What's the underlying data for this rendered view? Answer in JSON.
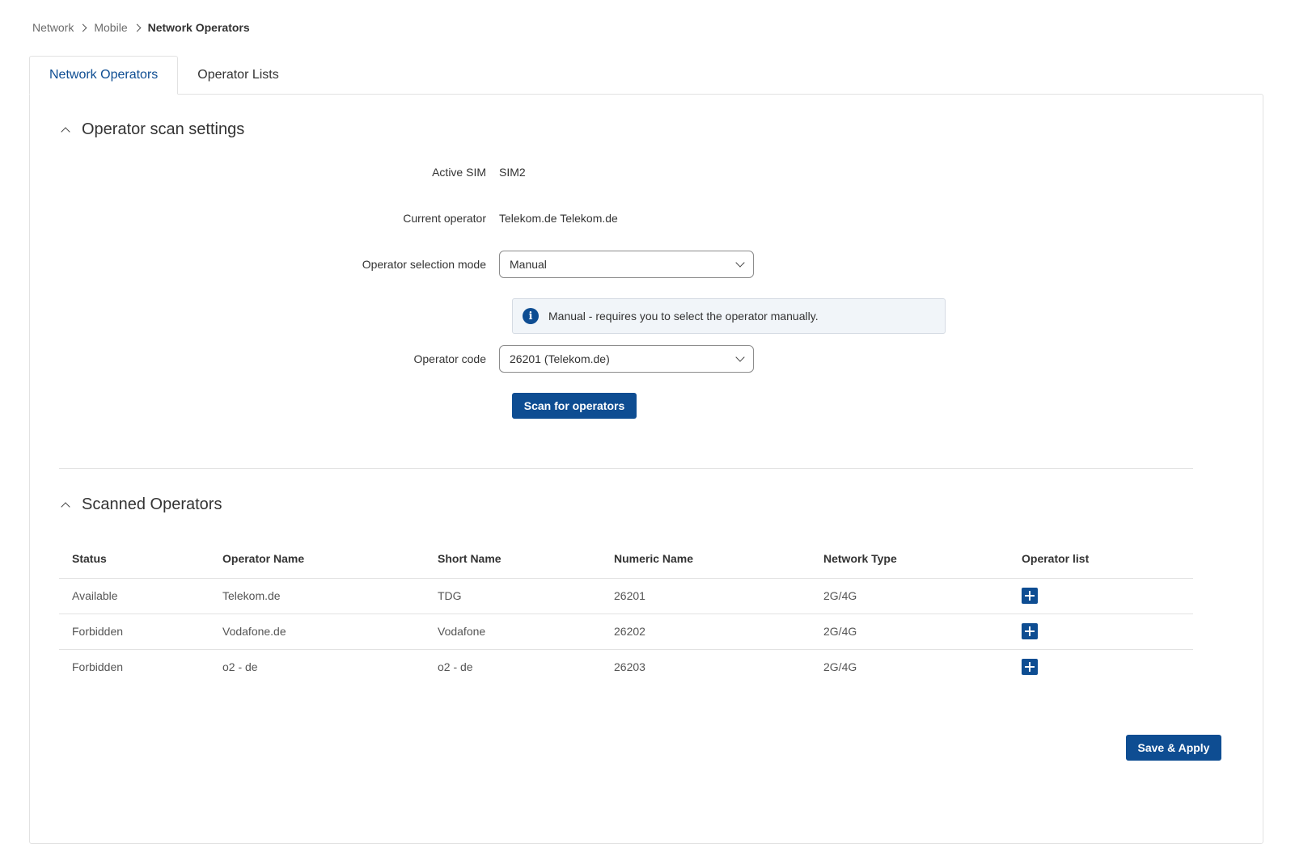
{
  "breadcrumb": {
    "items": [
      "Network",
      "Mobile"
    ],
    "current": "Network Operators"
  },
  "tabs": [
    {
      "label": "Network Operators",
      "active": true
    },
    {
      "label": "Operator Lists",
      "active": false
    }
  ],
  "scan_settings": {
    "title": "Operator scan settings",
    "active_sim_label": "Active SIM",
    "active_sim_value": "SIM2",
    "current_operator_label": "Current operator",
    "current_operator_value": "Telekom.de Telekom.de",
    "selection_mode_label": "Operator selection mode",
    "selection_mode_value": "Manual",
    "selection_mode_info": "Manual - requires you to select the operator manually.",
    "operator_code_label": "Operator code",
    "operator_code_value": "26201 (Telekom.de)",
    "scan_button": "Scan for operators"
  },
  "scanned": {
    "title": "Scanned Operators",
    "columns": [
      "Status",
      "Operator Name",
      "Short Name",
      "Numeric Name",
      "Network Type",
      "Operator list"
    ],
    "rows": [
      [
        "Available",
        "Telekom.de",
        "TDG",
        "26201",
        "2G/4G"
      ],
      [
        "Forbidden",
        "Vodafone.de",
        "Vodafone",
        "26202",
        "2G/4G"
      ],
      [
        "Forbidden",
        "o2 - de",
        "o2 - de",
        "26203",
        "2G/4G"
      ]
    ]
  },
  "save_button": "Save & Apply",
  "colors": {
    "accent": "#0e4d92",
    "border": "#e2e2e2",
    "info_bg": "#f1f5f9"
  }
}
